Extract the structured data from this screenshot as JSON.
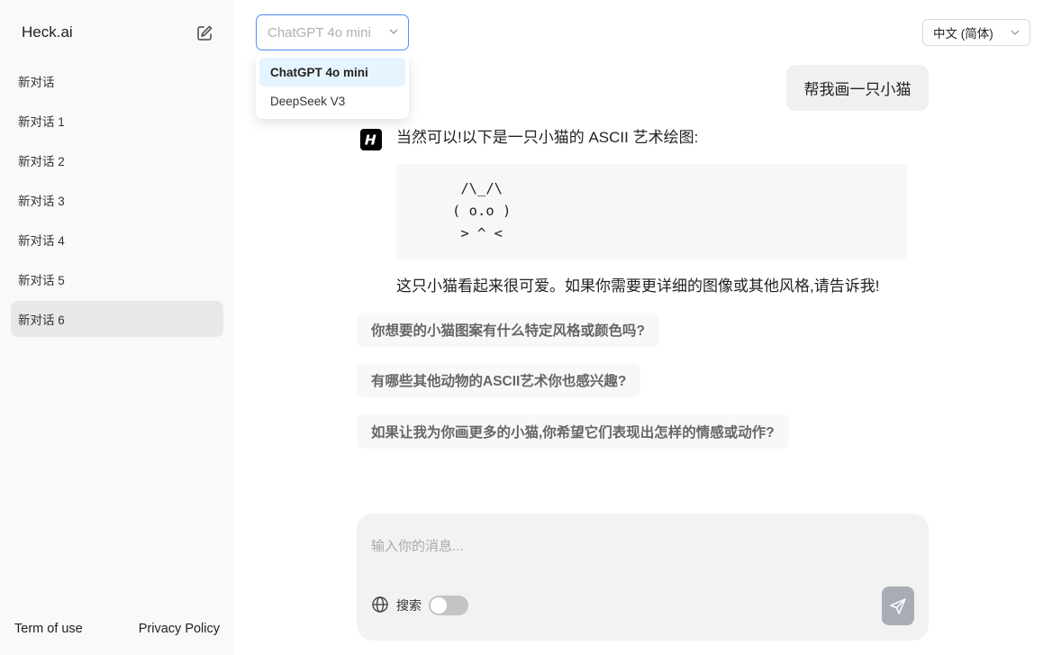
{
  "sidebar": {
    "brand": "Heck.ai",
    "conversations": [
      {
        "label": "新对话"
      },
      {
        "label": "新对话 1"
      },
      {
        "label": "新对话 2"
      },
      {
        "label": "新对话 3"
      },
      {
        "label": "新对话 4"
      },
      {
        "label": "新对话 5"
      },
      {
        "label": "新对话 6",
        "active": true
      }
    ],
    "footer": {
      "terms": "Term of use",
      "privacy": "Privacy Policy"
    }
  },
  "header": {
    "model_select": {
      "value": "ChatGPT 4o mini",
      "options": [
        "ChatGPT 4o mini",
        "DeepSeek V3"
      ],
      "selected_option": "ChatGPT 4o mini"
    },
    "language_select": {
      "value": "中文 (简体)"
    }
  },
  "chat": {
    "user_message": "帮我画一只小猫",
    "bot_intro": "当然可以!以下是一只小猫的 ASCII 艺术绘图:",
    "ascii_art": [
      " /\\_/\\",
      "( o.o )",
      " > ^ <"
    ],
    "bot_outro": "这只小猫看起来很可爱。如果你需要更详细的图像或其他风格,请告诉我!",
    "suggestions": [
      "你想要的小猫图案有什么特定风格或颜色吗?",
      "有哪些其他动物的ASCII艺术你也感兴趣?",
      "如果让我为你画更多的小猫,你希望它们表现出怎样的情感或动作?"
    ]
  },
  "composer": {
    "placeholder": "输入你的消息...",
    "value": "",
    "search_label": "搜索",
    "search_enabled": false
  },
  "colors": {
    "sidebar_bg": "#f9f9f9",
    "active_item_bg": "#e8e8e8",
    "select_border_focus": "#4a90ff",
    "dropdown_selected_bg": "#e6f4ff",
    "send_button": "#a8adb5"
  },
  "icons": {
    "new_chat": "edit-square-icon",
    "chevron": "chevron-down-icon",
    "bot": "heck-logo-icon",
    "globe": "globe-icon",
    "send": "send-icon"
  }
}
